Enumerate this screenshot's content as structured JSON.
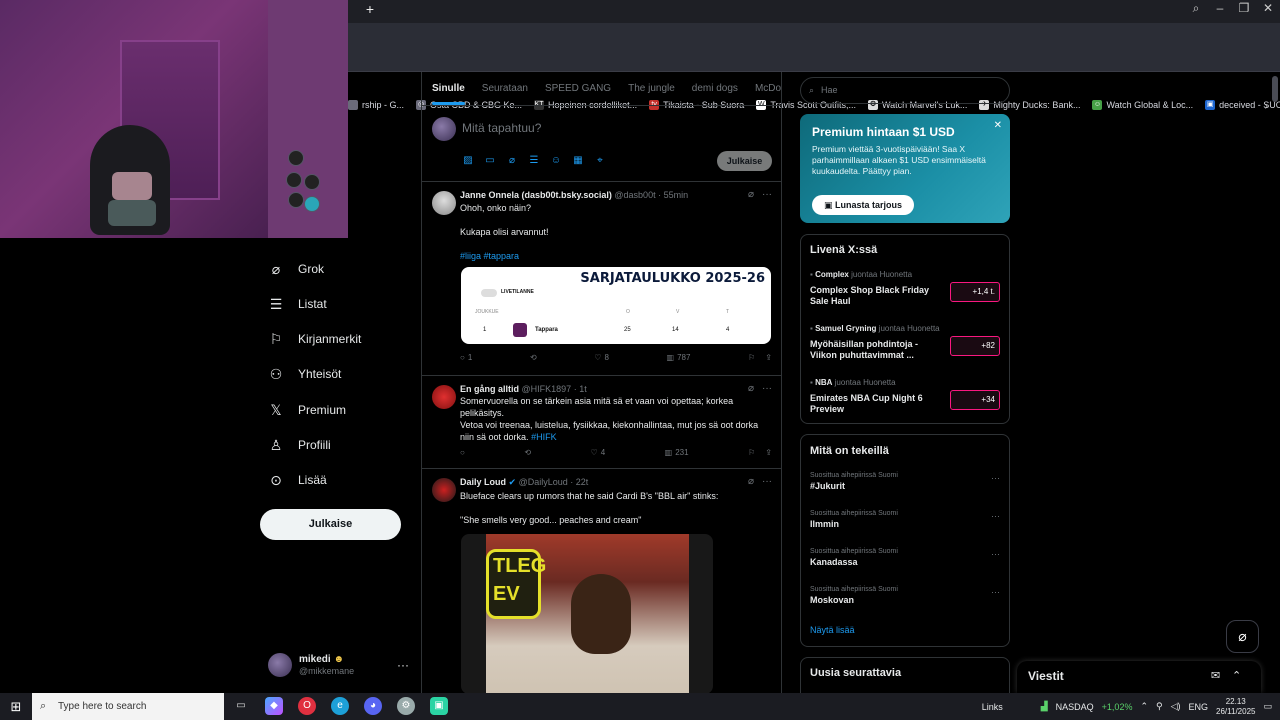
{
  "browser": {
    "new_tab": "+",
    "bookmarks": [
      {
        "label": "rship - G...",
        "icon_color": "#6a6a7a",
        "icon": ""
      },
      {
        "label": "Osta CBD & CBG Ke...",
        "icon_color": "#6a6a7a",
        "icon": "◎"
      },
      {
        "label": "Hopeinen cordelliket...",
        "icon_color": "#333",
        "icon": "KT"
      },
      {
        "label": "Tikaista - Sub Suora",
        "icon_color": "#c4302b",
        "icon": "tv"
      },
      {
        "label": "Travis Scott Outfits,...",
        "icon_color": "#fff",
        "icon": "W"
      },
      {
        "label": "Watch Marvel's Luk...",
        "icon_color": "#ddd",
        "icon": "✪"
      },
      {
        "label": "Mighty Ducks: Bank...",
        "icon_color": "#ddd",
        "icon": "✈"
      },
      {
        "label": "Watch Global & Loc...",
        "icon_color": "#46a046",
        "icon": "☺"
      },
      {
        "label": "deceived - SUORAT...",
        "icon_color": "#1d66d0",
        "icon": "▣"
      }
    ]
  },
  "nav": {
    "items": [
      {
        "label": "Grok",
        "icon": "grok-icon",
        "glyph": "⌀"
      },
      {
        "label": "Listat",
        "icon": "list-icon",
        "glyph": "☰"
      },
      {
        "label": "Kirjanmerkit",
        "icon": "bookmark-icon",
        "glyph": "⚐"
      },
      {
        "label": "Yhteisöt",
        "icon": "communities-icon",
        "glyph": "⚇"
      },
      {
        "label": "Premium",
        "icon": "x-logo-icon",
        "glyph": "𝕏"
      },
      {
        "label": "Profiili",
        "icon": "profile-icon",
        "glyph": "♙"
      },
      {
        "label": "Lisää",
        "icon": "more-icon",
        "glyph": "⊙"
      }
    ],
    "post_button": "Julkaise",
    "account": {
      "name": "mikedi",
      "handle": "@mikkemane"
    }
  },
  "feed": {
    "tabs": [
      {
        "label": "Sinulle",
        "active": true
      },
      {
        "label": "Seurataan",
        "active": false
      },
      {
        "label": "SPEED GANG",
        "active": false
      },
      {
        "label": "The jungle",
        "active": false
      },
      {
        "label": "demi dogs",
        "active": false
      },
      {
        "label": "McDonal",
        "active": false
      }
    ],
    "compose": {
      "placeholder": "Mitä tapahtuu?",
      "post_label": "Julkaise"
    },
    "tweets": [
      {
        "name": "Janne Onnela (dasb00t.bsky.social)",
        "handle": "@dasb00t",
        "time": "55min",
        "text1": "Ohoh, onko näin?",
        "text2": "Kukapa olisi arvannut!",
        "tags": "#liiga #tappara",
        "card": {
          "title": "SARJATAULUKKO 2025-26",
          "live_label": "LIVETILANNE",
          "col_team": "JOUKKUE",
          "col_o": "O",
          "col_v": "V",
          "col_t": "T",
          "rank": "1",
          "team": "Tappara",
          "o": "25",
          "v": "14",
          "t": "4"
        },
        "replies": "1",
        "reposts": "",
        "likes": "8",
        "views": "787"
      },
      {
        "name": "En gång alltid",
        "handle": "@HIFK1897",
        "time": "1t",
        "text1": "Somervuorella on se tärkein asia mitä sä et vaan voi opettaa; korkea pelikäsitys.",
        "text2": "Vetoa voi treenaa, luistelua, fysiikkaa, kiekonhallintaa, mut jos sä oot dorka niin sä oot dorka.",
        "tags": "#HIFK",
        "replies": "",
        "reposts": "",
        "likes": "4",
        "views": "231"
      },
      {
        "name": "Daily Loud",
        "handle": "@DailyLoud",
        "time": "22t",
        "text1": "Blueface clears up rumors that he said Cardi B's \"BBL air\" stinks:",
        "text2": "\"She smells very good... peaches and cream\"",
        "image_text": "TLEG EV"
      }
    ]
  },
  "right": {
    "search_placeholder": "Hae",
    "premium": {
      "title": "Premium hintaan $1 USD",
      "desc": "Premium viettää 3-vuotispäiviään! Saa X parhaimmillaan alkaen $1 USD ensimmäiseltä kuukaudelta. Päättyy pian.",
      "button": "Lunasta tarjous"
    },
    "live": {
      "title": "Livenä X:ssä",
      "items": [
        {
          "who": "Complex",
          "verb": "juontaa Huonetta",
          "title": "Complex Shop Black Friday Sale Haul",
          "count": "+1,4 t."
        },
        {
          "who": "Samuel Gryning",
          "verb": "juontaa Huonetta",
          "title": "Myöhäisillan pohdintoja - Viikon puhuttavimmat ...",
          "count": "+82"
        },
        {
          "who": "NBA",
          "verb": "juontaa Huonetta",
          "title": "Emirates NBA Cup Night 6 Preview",
          "count": "+34"
        }
      ]
    },
    "trends": {
      "title": "Mitä on tekeillä",
      "items": [
        {
          "ctx": "Suosittua aihepiirissä Suomi",
          "name": "#Jukurit"
        },
        {
          "ctx": "Suosittua aihepiirissä Suomi",
          "name": "Ilmmin"
        },
        {
          "ctx": "Suosittua aihepiirissä Suomi",
          "name": "Kanadassa"
        },
        {
          "ctx": "Suosittua aihepiirissä Suomi",
          "name": "Moskovan"
        }
      ],
      "show_more": "Näytä lisää"
    },
    "who_to_follow": "Uusia seurattavia",
    "messages": "Viestit"
  },
  "taskbar": {
    "search": "Type here to search",
    "links": "Links",
    "ticker_name": "NASDAQ",
    "ticker_change": "+1,02%",
    "lang": "ENG",
    "time": "22.13",
    "date": "26/11/2025"
  },
  "colors": {
    "accent": "#1d9bf0",
    "bg": "#000000",
    "border": "#2f3336"
  }
}
